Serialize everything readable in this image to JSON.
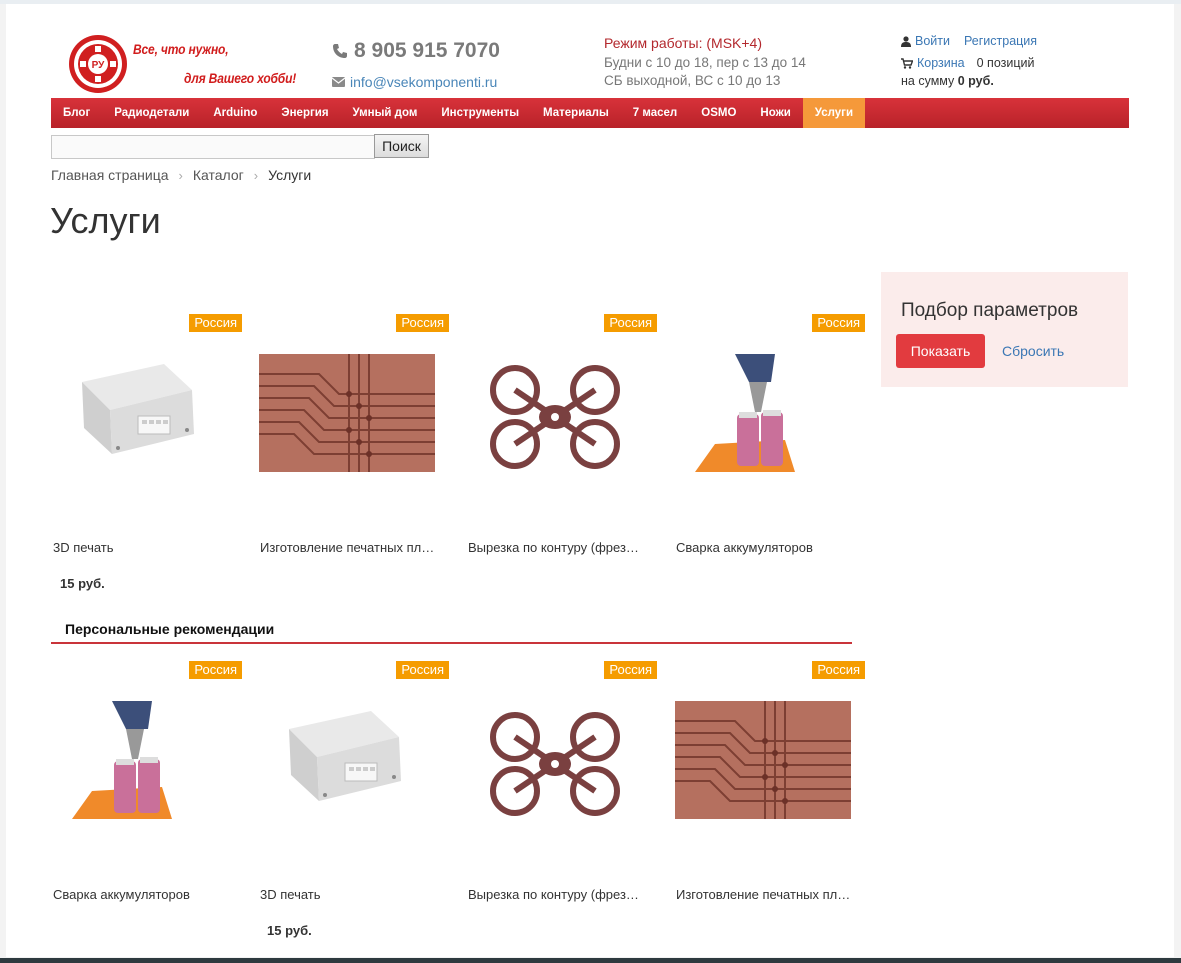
{
  "header": {
    "slogan_line1": "Все, что нужно,",
    "slogan_line2": "для Вашего хобби!",
    "phone": "8 905 915 7070",
    "email": "info@vsekomponenti.ru",
    "hours_title": "Режим работы: (MSK+4)",
    "hours_weekdays": "Будни с 10 до 18, пер с 13 до 14",
    "hours_weekend": "СБ выходной, ВС с 10 до 13",
    "login": "Войти",
    "register": "Регистрация",
    "cart_link": "Корзина",
    "cart_count": "0 позиций",
    "cart_sum_label": "на сумму",
    "cart_sum_value": "0 руб."
  },
  "nav": {
    "items": [
      "Блог",
      "Радиодетали",
      "Arduino",
      "Энергия",
      "Умный дом",
      "Инструменты",
      "Материалы",
      "7 масел",
      "OSMO",
      "Ножи",
      "Услуги"
    ],
    "active": "Услуги"
  },
  "search": {
    "button": "Поиск",
    "value": ""
  },
  "breadcrumb": [
    "Главная страница",
    "Каталог",
    "Услуги"
  ],
  "page_title": "Услуги",
  "products": [
    {
      "badge": "Россия",
      "name": "3D печать",
      "price": "15 руб.",
      "image": "box-enclosure"
    },
    {
      "badge": "Россия",
      "name": "Изготовление печатных пл…",
      "price": "",
      "image": "pcb"
    },
    {
      "badge": "Россия",
      "name": "Вырезка по контуру (фрез…",
      "price": "",
      "image": "drone-frame"
    },
    {
      "badge": "Россия",
      "name": "Сварка аккумуляторов",
      "price": "",
      "image": "battery-welding"
    }
  ],
  "recommendations": {
    "title": "Персональные рекомендации",
    "items": [
      {
        "badge": "Россия",
        "name": "Сварка аккумуляторов",
        "price": "",
        "image": "battery-welding"
      },
      {
        "badge": "Россия",
        "name": "3D печать",
        "price": "15 руб.",
        "image": "box-enclosure"
      },
      {
        "badge": "Россия",
        "name": "Вырезка по контуру (фрез…",
        "price": "",
        "image": "drone-frame"
      },
      {
        "badge": "Россия",
        "name": "Изготовление печатных пл…",
        "price": "",
        "image": "pcb"
      }
    ]
  },
  "filter": {
    "title": "Подбор параметров",
    "show": "Показать",
    "reset": "Сбросить"
  },
  "colors": {
    "nav_red": "#c62a31",
    "active_orange": "#f5993a",
    "badge": "#f59c00",
    "link": "#3b77b4"
  }
}
